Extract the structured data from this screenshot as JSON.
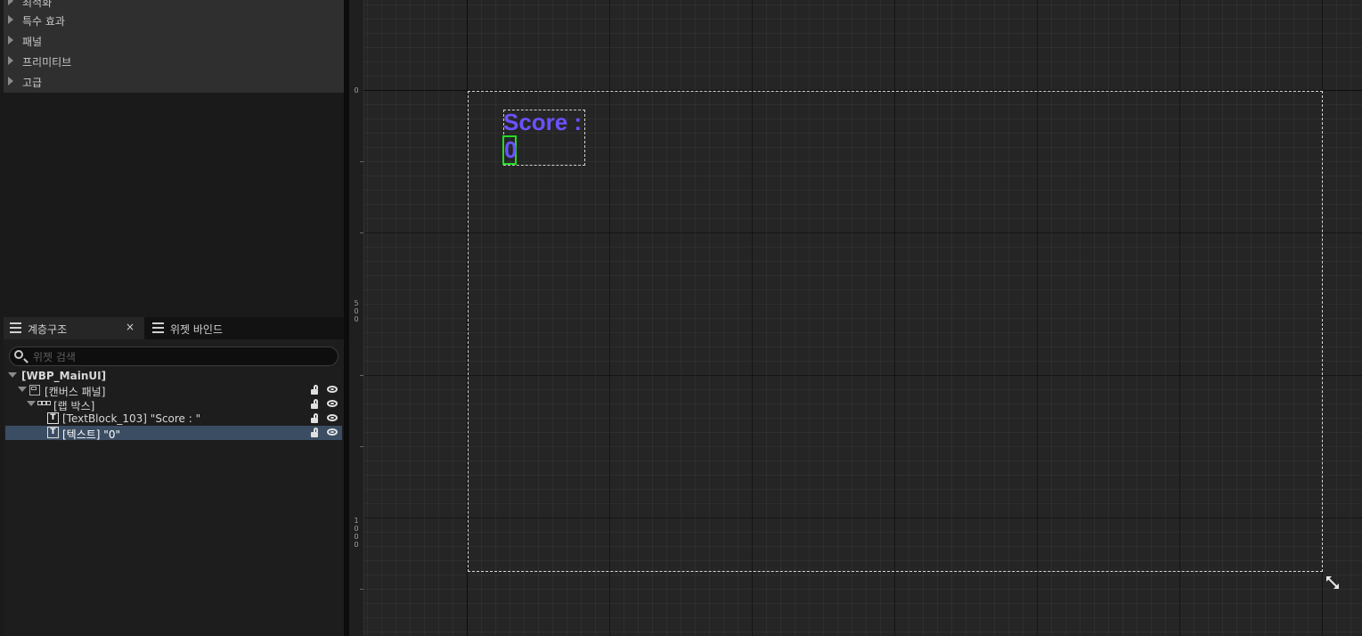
{
  "palette": {
    "categories": [
      {
        "label": "최적화"
      },
      {
        "label": "특수 효과"
      },
      {
        "label": "패널"
      },
      {
        "label": "프리미티브"
      },
      {
        "label": "고급"
      }
    ]
  },
  "tabs": {
    "hierarchy_label": "계층구조",
    "close_glyph": "×",
    "bind_label": "위젯 바인드"
  },
  "search": {
    "placeholder": "위젯 검색",
    "value": ""
  },
  "tree": {
    "root": "[WBP_MainUI]",
    "canvas_panel": "[캔버스 패널]",
    "wrap_box": "[랩 박스]",
    "text_block": "[TextBlock_103] \"Score : \"",
    "text_value": "[텍스트] \"0\"",
    "text_icon_glyph": "T"
  },
  "ruler": {
    "label_0": "0",
    "label_500": "500",
    "label_1000": "1000"
  },
  "canvas": {
    "score_label": "Score :",
    "score_value": "0",
    "text_color": "#6a52ff",
    "selection_color": "#22dd22"
  }
}
